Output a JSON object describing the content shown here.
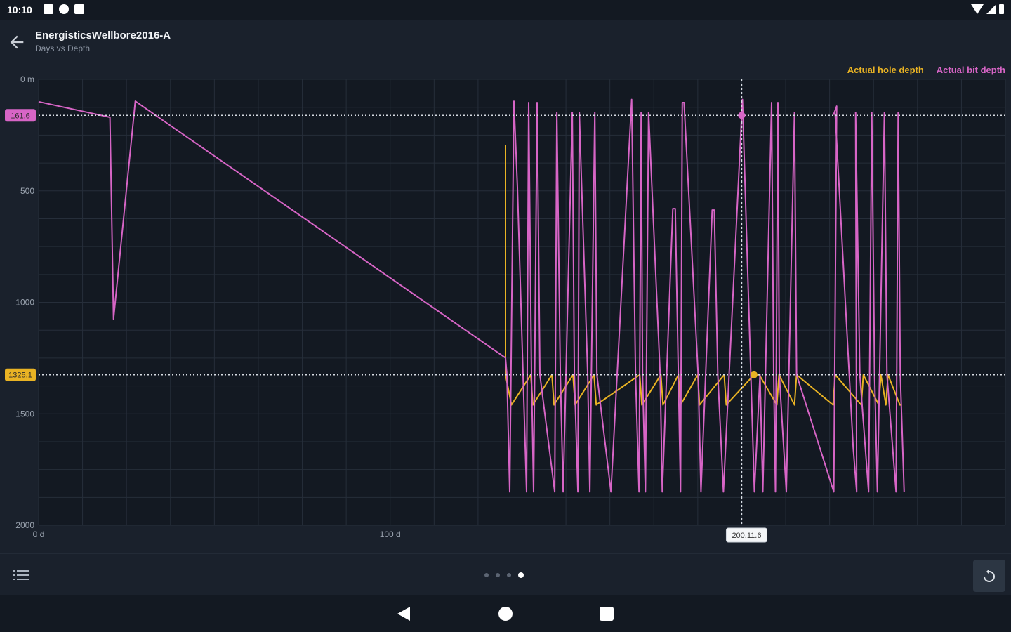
{
  "status_bar": {
    "time": "10:10"
  },
  "app_bar": {
    "title": "EnergisticsWellbore2016-A",
    "subtitle": "Days vs Depth",
    "icons": {
      "back": "arrow-left-icon"
    }
  },
  "legend": {
    "hole_label": "Actual hole depth",
    "bit_label": "Actual bit depth"
  },
  "colors": {
    "hole": "#e9b324",
    "bit": "#d765c6",
    "background": "#131922",
    "panel": "#1a212c",
    "grid": "#262e3a"
  },
  "chart_data": {
    "type": "line",
    "x_unit": "d",
    "y_unit": "m",
    "xlim": [
      0,
      275
    ],
    "ylim": [
      2000,
      0
    ],
    "y_ticks": [
      {
        "value": 0,
        "label": "0 m"
      },
      {
        "value": 500,
        "label": "500"
      },
      {
        "value": 1000,
        "label": "1000"
      },
      {
        "value": 1500,
        "label": "1500"
      },
      {
        "value": 2000,
        "label": "2000"
      }
    ],
    "x_ticks": [
      {
        "value": 0,
        "label": "0 d"
      },
      {
        "value": 100,
        "label": "100 d"
      }
    ],
    "grid": true,
    "legend_position": "top-right",
    "crosshair": {
      "x_label": "200.11.6",
      "bit_value": 161.6,
      "bit_label": "161.6",
      "hole_value": 1325.1,
      "hole_label": "1325.1",
      "bit_day": 200.0,
      "hole_day": 203.5
    },
    "series": [
      {
        "name": "Actual hole depth",
        "x": [
          132.8,
          132.8,
          132.8,
          134.5,
          140,
          140.6,
          146,
          146.6,
          152,
          152.6,
          158,
          158.6,
          171,
          171.6,
          177,
          177.6,
          182,
          182.6,
          187.5,
          188,
          195,
          195.6,
          203.5,
          205,
          210,
          210.6,
          215,
          215.6,
          226,
          226.6,
          234,
          234.6,
          239,
          239.6,
          241,
          241.6,
          245,
          245.4
        ],
        "y": [
          294,
          1325,
          1325,
          1460,
          1325,
          1460,
          1325,
          1460,
          1325,
          1460,
          1325,
          1460,
          1325,
          1460,
          1325,
          1460,
          1325,
          1460,
          1325,
          1460,
          1325,
          1460,
          1325,
          1325,
          1460,
          1325,
          1460,
          1325,
          1460,
          1325,
          1460,
          1325,
          1460,
          1325,
          1460,
          1325,
          1460,
          1460
        ]
      },
      {
        "name": "Actual bit depth",
        "x": [
          0,
          20.3,
          21.3,
          27.5,
          132.8,
          133.2,
          134,
          135.2,
          136.2,
          138.8,
          139.4,
          140.2,
          140.8,
          141.8,
          142.6,
          146.8,
          147.4,
          148.4,
          149.2,
          151.8,
          152.4,
          153.4,
          153.8,
          156.2,
          156.8,
          158.2,
          158.8,
          162.8,
          168.7,
          169.8,
          170.8,
          171.4,
          171.8,
          172.6,
          173.5,
          176.8,
          177.4,
          180.4,
          181.1,
          182.6,
          183.1,
          183.6,
          187.6,
          188.4,
          191.6,
          192.2,
          193.2,
          194.8,
          200.2,
          203.6,
          205.2,
          206,
          208.5,
          209.1,
          209.6,
          210.3,
          210.7,
          212.7,
          215,
          215.6,
          226.2,
          227,
          226.2,
          226.6,
          231.7,
          232.7,
          232.4,
          233.6,
          236.1,
          237,
          237.8,
          238.6,
          240.6,
          241.3,
          243.9,
          244.5,
          245.1,
          246.2
        ],
        "y": [
          100,
          170,
          1075,
          98,
          1249,
          1325,
          1850,
          98,
          485,
          1850,
          104,
          1325,
          1850,
          104,
          1325,
          1850,
          148,
          1325,
          1850,
          148,
          1325,
          1850,
          148,
          1325,
          1850,
          148,
          1325,
          1850,
          90,
          1325,
          1850,
          148,
          1325,
          1850,
          148,
          1325,
          1850,
          580,
          580,
          1850,
          104,
          104,
          1325,
          1850,
          586,
          586,
          1325,
          1850,
          90,
          1850,
          1325,
          1850,
          104,
          1325,
          1850,
          104,
          1325,
          1850,
          148,
          1325,
          1850,
          120,
          156,
          156,
          1650,
          1850,
          148,
          1325,
          1850,
          148,
          1325,
          1850,
          148,
          1325,
          1850,
          148,
          1325,
          1850
        ]
      }
    ]
  }
}
